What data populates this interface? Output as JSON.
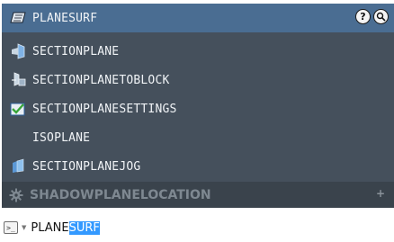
{
  "popup": {
    "header_label": "PLANESURF",
    "items": [
      {
        "label": "SECTIONPLANE",
        "icon": "section-plane-icon"
      },
      {
        "label": "SECTIONPLANETOBLOCK",
        "icon": "section-plane-to-block-icon"
      },
      {
        "label": "SECTIONPLANESETTINGS",
        "icon": "section-plane-settings-icon"
      },
      {
        "label": "ISOPLANE",
        "icon": null
      },
      {
        "label": "SECTIONPLANEJOG",
        "icon": "section-plane-jog-icon"
      }
    ],
    "footer_label": "SHADOWPLANELOCATION",
    "footer_plus": "+",
    "help_glyph": "?"
  },
  "command_line": {
    "typed_prefix": "PLANE",
    "typed_suffix": "SURF",
    "prompt_glyph": ">_",
    "caret_glyph": "▼"
  },
  "colors": {
    "popup_bg": "#45505c",
    "selected_bg": "#4a6d92",
    "footer_bg": "#3a434c",
    "highlight": "#3399ff"
  }
}
